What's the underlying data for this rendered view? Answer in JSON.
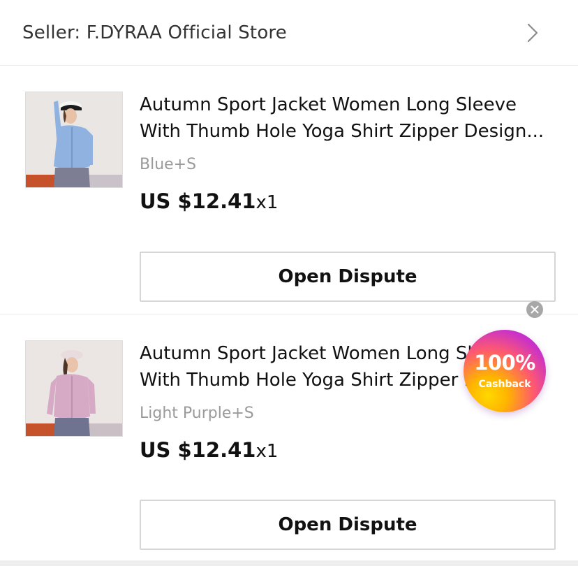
{
  "seller": {
    "label": "Seller: F.DYRAA Official Store",
    "chevron_icon": "chevron-right-icon"
  },
  "items": [
    {
      "title_line1": "Autumn Sport Jacket Women Long Sleeve",
      "title_line2": "With Thumb Hole Yoga Shirt Zipper Design...",
      "variant": "Blue+S",
      "price": "US $12.41",
      "quantity": "x1",
      "button_label": "Open Dispute",
      "thumbnail_colors": {
        "jacket": "#8fb2e0",
        "background": "#e9e6e3",
        "floor": "#c5522a"
      }
    },
    {
      "title_line1": "Autumn Sport Jacket Women Long Sleeve",
      "title_line2": "With Thumb Hole Yoga Shirt Zipper Design...",
      "variant": "Light Purple+S",
      "price": "US $12.41",
      "quantity": "x1",
      "button_label": "Open Dispute",
      "thumbnail_colors": {
        "jacket": "#d6a9c4",
        "background": "#ebe6e4",
        "floor": "#c5522a"
      }
    }
  ],
  "cashback_badge": {
    "percent": "100%",
    "label": "Cashback",
    "close_icon": "close-icon"
  }
}
